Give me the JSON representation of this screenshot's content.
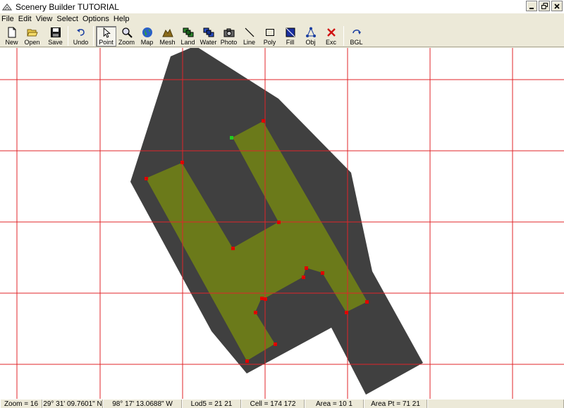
{
  "window": {
    "title": "Scenery Builder  TUTORIAL"
  },
  "menu": [
    "File",
    "Edit",
    "View",
    "Select",
    "Options",
    "Help"
  ],
  "toolbar": {
    "new": "New",
    "open": "Open",
    "save": "Save",
    "undo": "Undo",
    "point": "Point",
    "zoom": "Zoom",
    "map": "Map",
    "mesh": "Mesh",
    "land": "Land",
    "water": "Water",
    "photo": "Photo",
    "line": "Line",
    "poly": "Poly",
    "fill": "Fill",
    "obj": "Obj",
    "exc": "Exc",
    "bgl": "BGL"
  },
  "status": {
    "zoom": "Zoom = 16",
    "lat": "29° 31' 09.7601\" N",
    "lon": "98° 17' 13.0688\" W",
    "lod5": "Lod5 = 21 21",
    "cell": "Cell = 174 172",
    "area": "Area = 10 1",
    "area_pt": "Area Pt = 71 21"
  },
  "colors": {
    "grid": "#e0242a",
    "outer_polygon": "#404040",
    "inner_polygon": "#6b7a1a",
    "vertex": "#e00000",
    "selected_vertex": "#22cc22"
  }
}
